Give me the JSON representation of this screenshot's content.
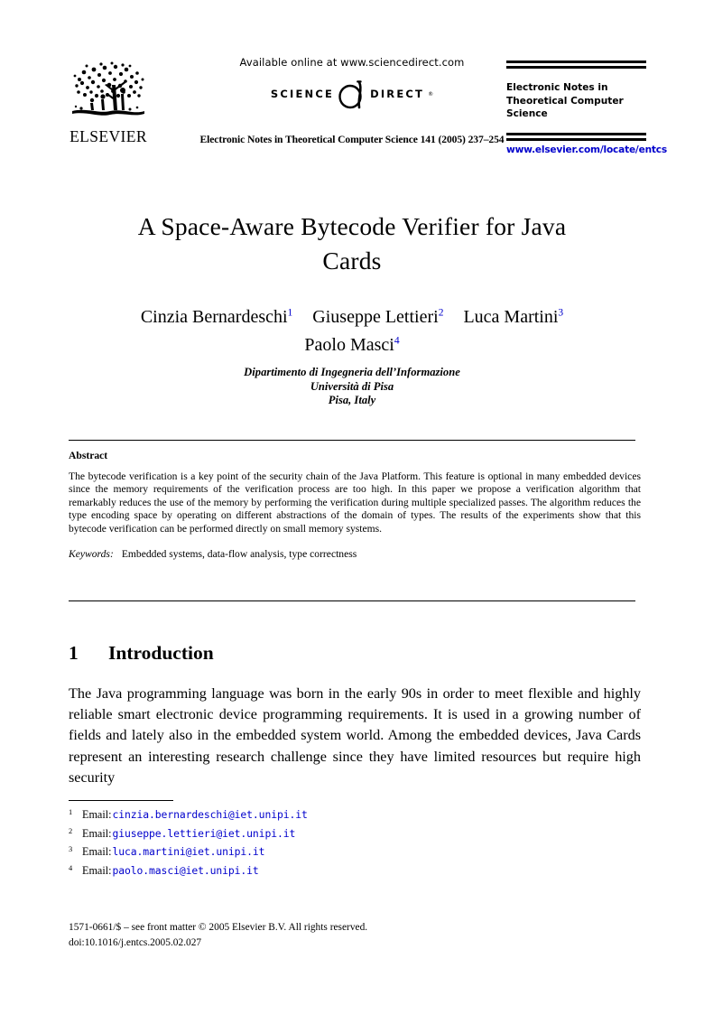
{
  "masthead": {
    "publisher_name": "ELSEVIER",
    "publisher_logo_icon": "elsevier-tree-logo",
    "sciencedirect": {
      "available_text": "Available online at www.sciencedirect.com",
      "logo_left_word": "SCIENCE",
      "logo_mark_icon": "sciencedirect-d-mark",
      "logo_right_word": "DIRECT",
      "logo_superscript": "®"
    },
    "citation": "Electronic Notes in Theoretical Computer Science 141 (2005) 237–254",
    "journal": {
      "name_line1": "Electronic Notes in",
      "name_line2": "Theoretical Computer",
      "name_line3": "Science",
      "url": "www.elsevier.com/locate/entcs",
      "url_color": "#0000cc"
    }
  },
  "title": {
    "line1": "A Space-Aware Bytecode Verifier for Java",
    "line2": "Cards"
  },
  "authors": {
    "row1": [
      {
        "name": "Cinzia Bernardeschi",
        "footnote": "1"
      },
      {
        "name": "Giuseppe Lettieri",
        "footnote": "2"
      },
      {
        "name": "Luca Martini",
        "footnote": "3"
      }
    ],
    "row2": [
      {
        "name": "Paolo Masci",
        "footnote": "4"
      }
    ]
  },
  "affiliation": {
    "line1": "Dipartimento di Ingegneria dell’Informazione",
    "line2": "Università di Pisa",
    "line3": "Pisa, Italy"
  },
  "abstract": {
    "heading": "Abstract",
    "text": "The bytecode verification is a key point of the security chain of the Java Platform. This feature is optional in many embedded devices since the memory requirements of the verification process are too high. In this paper we propose a verification algorithm that remarkably reduces the use of the memory by performing the verification during multiple specialized passes. The algorithm reduces the type encoding space by operating on different abstractions of the domain of types. The results of the experiments show that this bytecode verification can be performed directly on small memory systems.",
    "keywords_label": "Keywords:",
    "keywords_values": "Embedded systems, data-flow analysis, type correctness"
  },
  "section": {
    "number": "1",
    "heading": "Introduction",
    "body": "The Java programming language was born in the early 90s in order to meet flexible and highly reliable smart electronic device programming requirements. It is used in a growing number of fields and lately also in the embedded system world. Among the embedded devices, Java Cards represent an interesting research challenge since they have limited resources but require high security"
  },
  "footnotes": [
    {
      "number": "1",
      "label": "Email:",
      "email": "cinzia.bernardeschi@iet.unipi.it"
    },
    {
      "number": "2",
      "label": "Email:",
      "email": "giuseppe.lettieri@iet.unipi.it"
    },
    {
      "number": "3",
      "label": "Email:",
      "email": "luca.martini@iet.unipi.it"
    },
    {
      "number": "4",
      "label": "Email:",
      "email": "paolo.masci@iet.unipi.it"
    }
  ],
  "footer": {
    "line1": "1571-0661/$ – see front matter © 2005 Elsevier B.V. All rights reserved.",
    "line2": "doi:10.1016/j.entcs.2005.02.027"
  }
}
